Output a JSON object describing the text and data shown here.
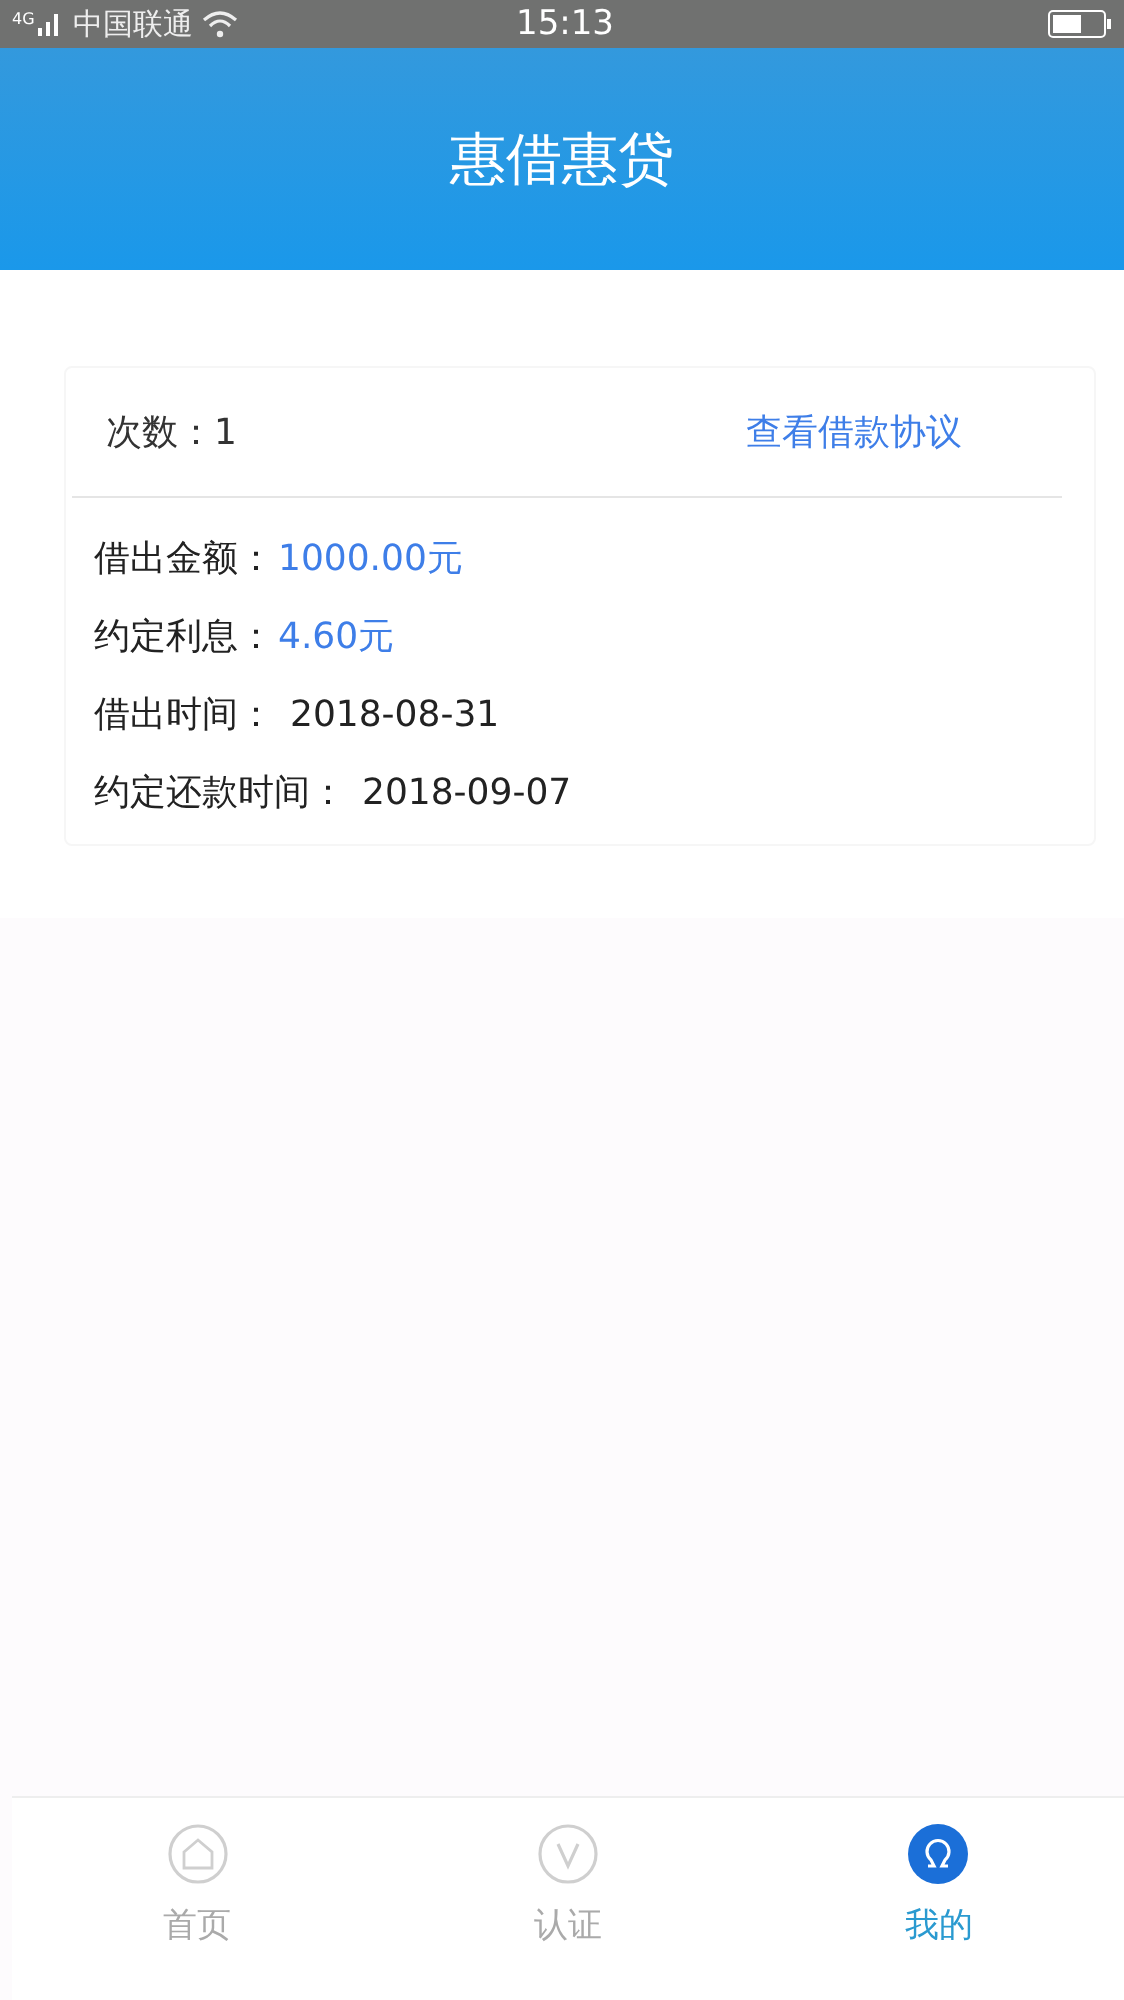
{
  "status_bar": {
    "network": "4G",
    "carrier": "中国联通",
    "time": "15:13"
  },
  "header": {
    "title": "惠借惠贷"
  },
  "loan": {
    "count_label": "次数：",
    "count": "1",
    "agreement_link": "查看借款协议",
    "details": [
      {
        "label": "借出金额：",
        "value": "1000.00元",
        "highlight": true
      },
      {
        "label": "约定利息：",
        "value": "4.60元",
        "highlight": true
      },
      {
        "label": "借出时间：",
        "value": "2018-08-31",
        "highlight": false
      },
      {
        "label": "约定还款时间：",
        "value": "2018-09-07",
        "highlight": false
      }
    ]
  },
  "tab_bar": [
    {
      "kind": "home",
      "label": "首页",
      "selected": false
    },
    {
      "kind": "verify",
      "label": "认证",
      "selected": false
    },
    {
      "kind": "mine",
      "label": "我的",
      "selected": true
    }
  ]
}
